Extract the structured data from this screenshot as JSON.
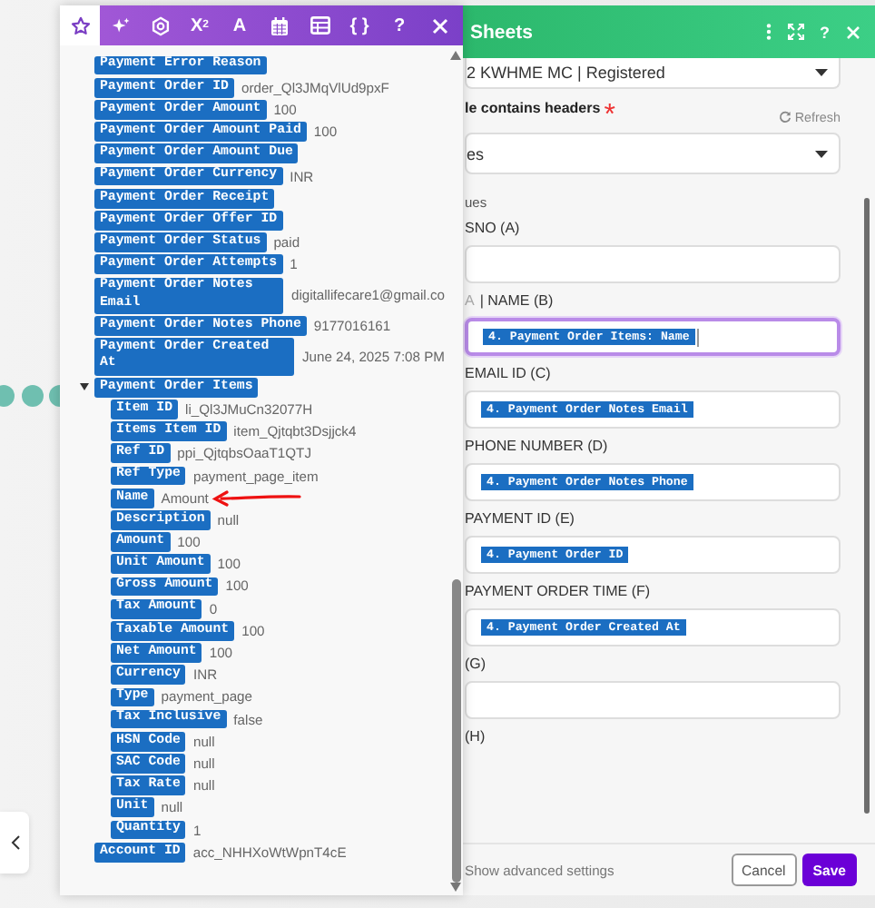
{
  "picker": {
    "tabs": [
      {
        "kind": "star",
        "selected": true
      },
      {
        "kind": "sparkle",
        "selected": false
      },
      {
        "kind": "gear",
        "selected": false
      },
      {
        "kind": "glyph",
        "glyph": "X$^{2}$",
        "selected": false
      },
      {
        "kind": "glyph",
        "glyph": "A",
        "selected": false
      },
      {
        "kind": "calendar",
        "selected": false
      },
      {
        "kind": "table",
        "selected": false
      },
      {
        "kind": "glyph",
        "glyph": "{ }",
        "selected": false
      },
      {
        "kind": "glyph",
        "glyph": "?",
        "selected": false
      },
      {
        "kind": "close",
        "selected": false
      }
    ],
    "items": [
      {
        "label": "Payment Error Reason"
      },
      {
        "label": "Payment Order ID",
        "value": "order_Ql3JMqVlUd9pxF"
      },
      {
        "label": "Payment Order Amount",
        "value": "100"
      },
      {
        "label": "Payment Order Amount Paid",
        "value": "100"
      },
      {
        "label": "Payment Order Amount Due"
      },
      {
        "label": "Payment Order Currency",
        "value": "INR"
      },
      {
        "label": "Payment Order Receipt"
      },
      {
        "label": "Payment Order Offer ID"
      },
      {
        "label": "Payment Order Status",
        "value": "paid"
      },
      {
        "label": "Payment Order Attempts",
        "value": "1"
      },
      {
        "label": "Payment Order Notes Email",
        "value": "digitallifecare1@gmail.co"
      },
      {
        "label": "Payment Order Notes Phone",
        "value": "9177016161"
      },
      {
        "label": "Payment Order Created At",
        "value": "June 24, 2025 7:08 PM"
      },
      {
        "label": "Payment Order Items",
        "expanded": true,
        "children": [
          {
            "label": "Item ID",
            "value": "li_Ql3JMuCn32077H"
          },
          {
            "label": "Items Item ID",
            "value": "item_Qjtqbt3Dsjjck4"
          },
          {
            "label": "Ref ID",
            "value": "ppi_QjtqbsOaaT1QTJ"
          },
          {
            "label": "Ref Type",
            "value": "payment_page_item"
          },
          {
            "label": "Name",
            "value": "Amount",
            "annotated": true
          },
          {
            "label": "Description",
            "value": "null"
          },
          {
            "label": "Amount",
            "value": "100"
          },
          {
            "label": "Unit Amount",
            "value": "100"
          },
          {
            "label": "Gross Amount",
            "value": "100"
          },
          {
            "label": "Tax Amount",
            "value": "0"
          },
          {
            "label": "Taxable Amount",
            "value": "100"
          },
          {
            "label": "Net Amount",
            "value": "100"
          },
          {
            "label": "Currency",
            "value": "INR"
          },
          {
            "label": "Type",
            "value": "payment_page"
          },
          {
            "label": "Tax Inclusive",
            "value": "false"
          },
          {
            "label": "HSN Code",
            "value": "null"
          },
          {
            "label": "SAC Code",
            "value": "null"
          },
          {
            "label": "Tax Rate",
            "value": "null"
          },
          {
            "label": "Unit",
            "value": "null"
          },
          {
            "label": "Quantity",
            "value": "1"
          }
        ]
      },
      {
        "label": "Account ID",
        "value": "acc_NHHXoWtWpnT4cE"
      }
    ]
  },
  "sheets": {
    "title": "Sheets",
    "help": "?",
    "connection": {
      "value": "2 KWHME MC | Registered"
    },
    "headers": {
      "label": "le contains headers",
      "required_mark": "*",
      "refresh": "Refresh",
      "value": "es"
    },
    "section": "ues",
    "columns": [
      {
        "label": "SNO (A)",
        "focused": false
      },
      {
        "prefix": "A",
        "label": "| NAME (B)",
        "token": "4. Payment Order Items: Name",
        "focused": true
      },
      {
        "label": "EMAIL ID (C)",
        "token": "4. Payment Order Notes Email",
        "focused": false
      },
      {
        "label": "PHONE NUMBER (D)",
        "token": "4. Payment Order Notes Phone",
        "focused": false
      },
      {
        "label": "PAYMENT ID (E)",
        "token": "4. Payment Order ID",
        "focused": false
      },
      {
        "label": "PAYMENT ORDER TIME (F)",
        "token": "4. Payment Order Created At",
        "focused": false
      },
      {
        "label": "(G)",
        "focused": false
      }
    ],
    "next_label": "(H)",
    "advanced": "Show advanced settings",
    "cancel": "Cancel",
    "save": "Save"
  }
}
